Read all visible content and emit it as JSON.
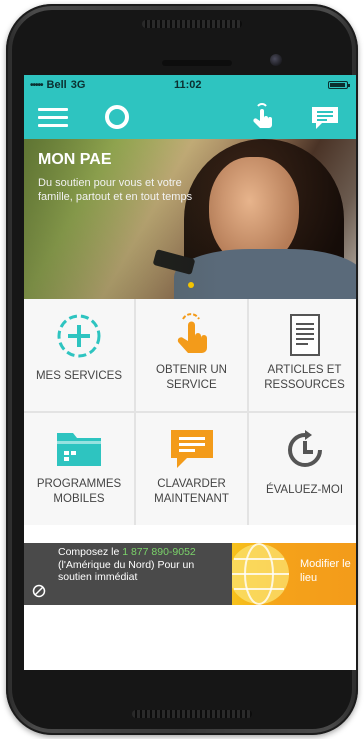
{
  "status_bar": {
    "signal": "•••••",
    "carrier": "Bell",
    "network": "3G",
    "time": "11:02"
  },
  "app_bar": {
    "menu_icon": "hamburger-icon",
    "logo_icon": "ring-logo-icon",
    "touch_icon": "touch-hand-icon",
    "chat_icon": "chat-bubble-icon"
  },
  "hero": {
    "title": "MON PAE",
    "subtitle": "Du soutien pour vous et votre famille, partout et en tout temps"
  },
  "tiles": [
    {
      "label": "MES SERVICES",
      "icon": "plus-circle-icon"
    },
    {
      "label": "OBTENIR UN SERVICE",
      "icon": "touch-hand-icon"
    },
    {
      "label": "ARTICLES ET RESSOURCES",
      "icon": "document-icon"
    },
    {
      "label": "PROGRAMMES MOBILES",
      "icon": "folder-icon"
    },
    {
      "label": "CLAVARDER MAINTENANT",
      "icon": "chat-icon"
    },
    {
      "label": "ÉVALUEZ-MOI",
      "icon": "clock-icon"
    }
  ],
  "banner": {
    "line_prefix": "Composez le ",
    "phone": "1 877 890-9052",
    "line_suffix": " (l'Amérique du Nord) Pour un soutien immédiat",
    "modify": "Modifier le lieu"
  },
  "colors": {
    "teal": "#2ec4c0",
    "orange": "#f39b1a",
    "banner_dark": "#4a4a4a",
    "phone_green": "#7bd36a"
  }
}
